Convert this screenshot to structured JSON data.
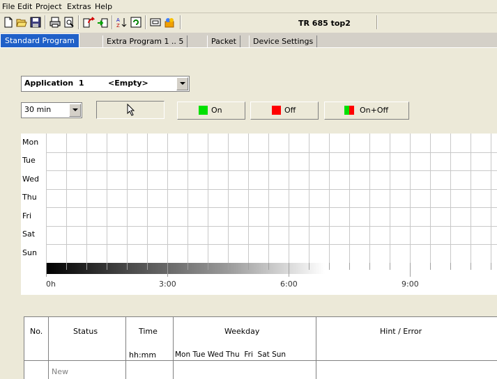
{
  "menu": [
    "File",
    "Edit",
    "Project",
    "Extras",
    "Help"
  ],
  "toolbar": {
    "buttons": [
      "new-icon",
      "open-icon",
      "save-icon",
      "print-icon",
      "preview-icon",
      "upload-icon",
      "download-icon",
      "sort-icon",
      "refresh-icon",
      "device-icon",
      "users-icon"
    ],
    "title": "TR 685 top2"
  },
  "tabs": [
    "Standard Program",
    "Extra Program 1 .. 5",
    "Packet",
    "Device Settings"
  ],
  "application": {
    "label": "Application  1",
    "value": "<Empty>"
  },
  "interval": "30 min",
  "buttons": {
    "on": "On",
    "off": "Off",
    "onoff": "On+Off"
  },
  "colors": {
    "on": "#00e000",
    "off": "#ff0000",
    "tab_active": "#2060c8"
  },
  "days": [
    "Mon",
    "Tue",
    "Wed",
    "Thu",
    "Fri",
    "Sat",
    "Sun"
  ],
  "time_labels": [
    "0h",
    "3:00",
    "6:00",
    "9:00"
  ],
  "table": {
    "headers": {
      "no": "No.",
      "status": "Status",
      "time": "Time",
      "time_unit": "hh:mm",
      "weekday": "Weekday",
      "weekday_sub": "Mon Tue Wed Thu  Fri  Sat Sun",
      "hint": "Hint / Error"
    },
    "rows": [
      {
        "status": "New"
      }
    ]
  }
}
